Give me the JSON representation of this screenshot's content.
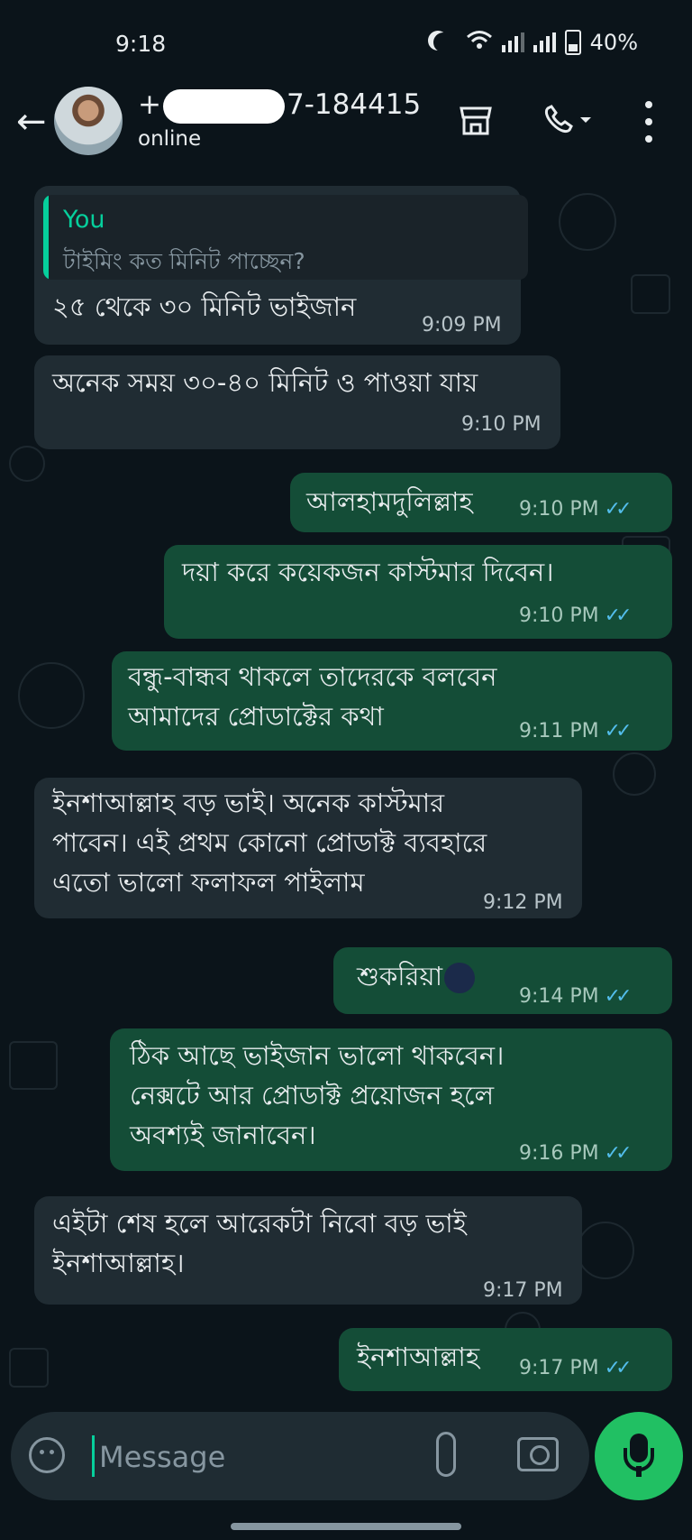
{
  "status_bar": {
    "time": "9:18",
    "battery": "40%"
  },
  "header": {
    "back_icon": "arrow-left-icon",
    "name_prefix": "+",
    "name_suffix": "7-184415",
    "status": "online",
    "icons": [
      "shop-icon",
      "call-icon",
      "more-vertical-icon"
    ]
  },
  "messages": [
    {
      "dir": "in",
      "quote_author": "You",
      "quote_text": "টাইমিং কত মিনিট পাচ্ছেন?",
      "lines": [
        "২৫ থেকে ৩০ মিনিট ভাইজান"
      ],
      "time": "9:09 PM"
    },
    {
      "dir": "in",
      "lines": [
        "অনেক সময় ৩০-৪০ মিনিট ও পাওয়া যায়"
      ],
      "time": "9:10 PM"
    },
    {
      "dir": "out",
      "lines": [
        "আলহামদুলিল্লাহ"
      ],
      "time": "9:10 PM"
    },
    {
      "dir": "out",
      "lines": [
        "দয়া করে কয়েকজন কাস্টমার দিবেন।"
      ],
      "time": "9:10 PM"
    },
    {
      "dir": "out",
      "lines": [
        "বন্ধু-বান্ধব থাকলে তাদেরকে বলবেন",
        "আমাদের প্রোডাক্টের কথা"
      ],
      "time": "9:11 PM"
    },
    {
      "dir": "in",
      "lines": [
        "ইনশাআল্লাহ বড় ভাই। অনেক কাস্টমার",
        "পাবেন। এই প্রথম কোনো প্রোডাক্ট ব্যবহারে",
        "এতো ভালো ফলাফল পাইলাম"
      ],
      "time": "9:12 PM"
    },
    {
      "dir": "out",
      "lines": [
        "শুকরিয়া"
      ],
      "emoji": "blue-heart",
      "time": "9:14 PM"
    },
    {
      "dir": "out",
      "lines": [
        "ঠিক আছে ভাইজান ভালো থাকবেন।",
        "নেক্সটে আর প্রোডাক্ট প্রয়োজন হলে",
        "অবশ্যই জানাবেন।"
      ],
      "time": "9:16 PM"
    },
    {
      "dir": "in",
      "lines": [
        "এইটা শেষ হলে আরেকটা নিবো বড় ভাই",
        "ইনশাআল্লাহ।"
      ],
      "time": "9:17 PM"
    },
    {
      "dir": "out",
      "lines": [
        "ইনশাআল্লাহ"
      ],
      "time": "9:17 PM"
    }
  ],
  "read_ticks": "✓✓",
  "composer": {
    "placeholder": "Message"
  },
  "colors": {
    "incoming": "#202c33",
    "outgoing": "#144d37",
    "ticks": "#53bdeb",
    "accent": "#21c063"
  }
}
